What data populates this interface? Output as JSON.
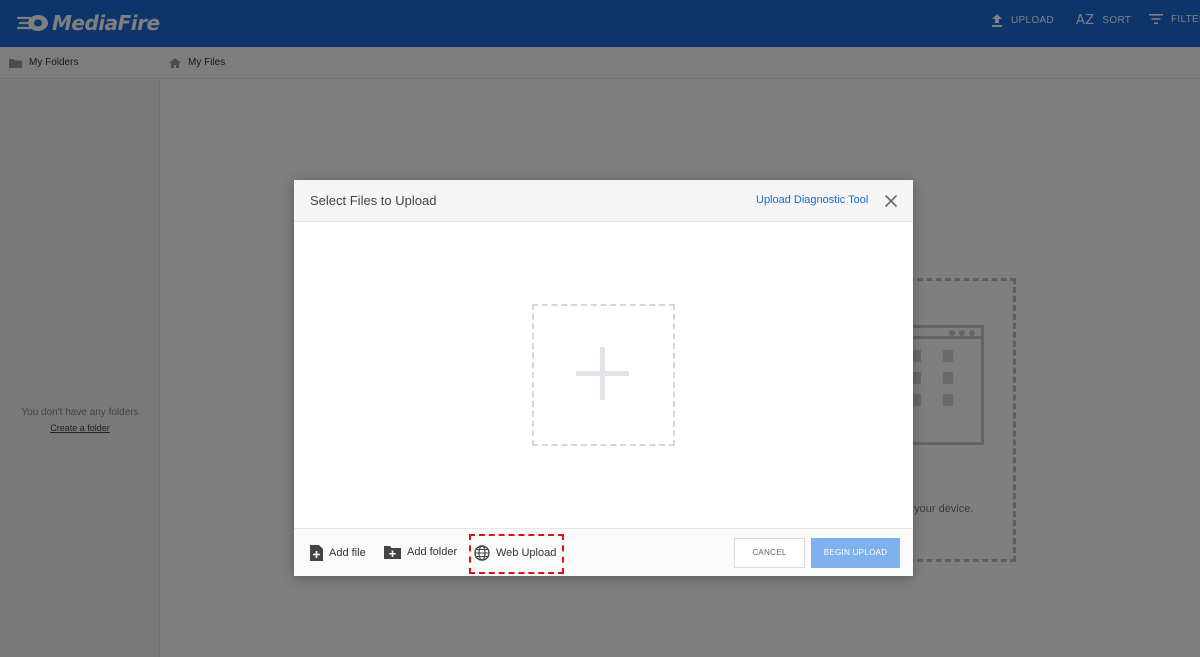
{
  "header": {
    "logo_text": "MediaFire",
    "upload_label": "UPLOAD",
    "sort_label": "SORT",
    "filter_label": "FILTER",
    "sort_icon_text": "AZ"
  },
  "breadcrumb": {
    "folders_label": "My Folders",
    "files_label": "My Files"
  },
  "sidebar": {
    "empty_text": "You don't have any folders",
    "create_folder_link": "Create a folder"
  },
  "main": {
    "device_text": "n your device."
  },
  "dialog": {
    "title": "Select Files to Upload",
    "diagnostic_link": "Upload Diagnostic Tool",
    "footer": {
      "add_file": "Add file",
      "add_folder": "Add folder",
      "web_upload": "Web Upload",
      "cancel": "CANCEL",
      "begin_upload": "BEGIN UPLOAD"
    }
  },
  "colors": {
    "brand_blue": "#1a6ad8",
    "begin_button": "#7fb1ee",
    "highlight_red": "#e01010"
  },
  "icons": [
    "mediafire-logo-icon",
    "upload-icon",
    "sort-icon",
    "filter-icon",
    "folder-icon",
    "home-icon",
    "close-icon",
    "plus-icon",
    "add-file-icon",
    "add-folder-icon",
    "globe-icon"
  ]
}
